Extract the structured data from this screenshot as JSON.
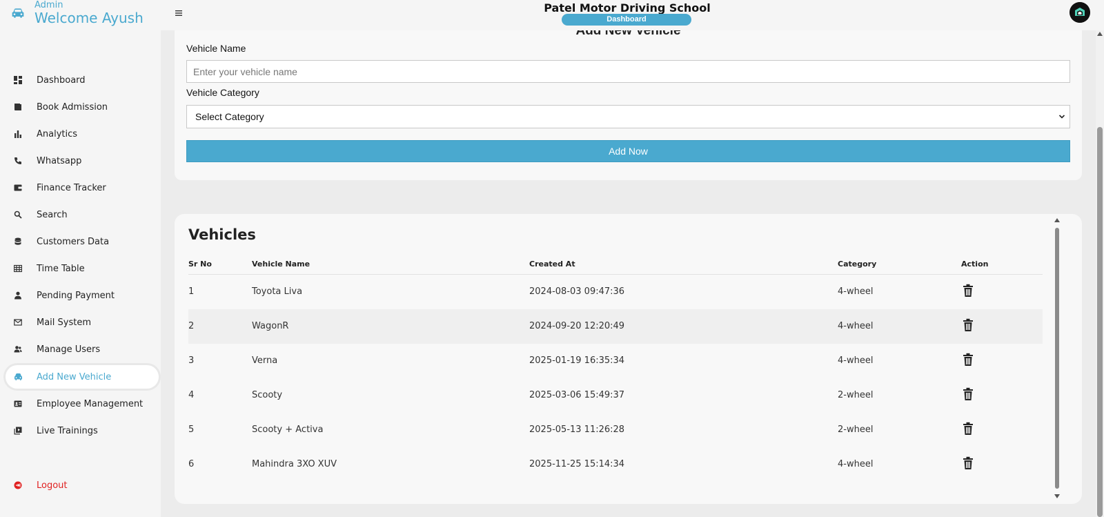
{
  "header": {
    "admin_label": "Admin",
    "welcome": "Welcome Ayush",
    "school_name": "Patel Motor Driving School",
    "badge": "Dashboard"
  },
  "sidebar": {
    "items": [
      {
        "label": "Dashboard",
        "icon": "dashboard-icon"
      },
      {
        "label": "Book Admission",
        "icon": "book-icon"
      },
      {
        "label": "Analytics",
        "icon": "bar-chart-icon"
      },
      {
        "label": "Whatsapp",
        "icon": "phone-icon"
      },
      {
        "label": "Finance Tracker",
        "icon": "wallet-icon"
      },
      {
        "label": "Search",
        "icon": "search-icon"
      },
      {
        "label": "Customers Data",
        "icon": "database-icon"
      },
      {
        "label": "Time Table",
        "icon": "table-icon"
      },
      {
        "label": "Pending Payment",
        "icon": "person-icon"
      },
      {
        "label": "Mail System",
        "icon": "mail-icon"
      },
      {
        "label": "Manage Users",
        "icon": "users-icon"
      },
      {
        "label": "Add New Vehicle",
        "icon": "car-icon"
      },
      {
        "label": "Employee Management",
        "icon": "id-card-icon"
      },
      {
        "label": "Live Trainings",
        "icon": "video-library-icon"
      }
    ],
    "active": "Add New Vehicle",
    "logout": "Logout"
  },
  "form": {
    "heading": "Add New Vehicle",
    "vehicle_name_label": "Vehicle Name",
    "vehicle_name_placeholder": "Enter your vehicle name",
    "vehicle_name_value": "",
    "category_label": "Vehicle Category",
    "category_selected": "Select Category",
    "submit_label": "Add Now"
  },
  "table": {
    "title": "Vehicles",
    "columns": [
      "Sr No",
      "Vehicle Name",
      "Created At",
      "Category",
      "Action"
    ],
    "rows": [
      [
        "1",
        "Toyota Liva",
        "2024-08-03 09:47:36",
        "4-wheel"
      ],
      [
        "2",
        "WagonR",
        "2024-09-20 12:20:49",
        "4-wheel"
      ],
      [
        "3",
        "Verna",
        "2025-01-19 16:35:34",
        "4-wheel"
      ],
      [
        "4",
        "Scooty",
        "2025-03-06 15:49:37",
        "2-wheel"
      ],
      [
        "5",
        "Scooty + Activa",
        "2025-05-13 11:26:28",
        "2-wheel"
      ],
      [
        "6",
        "Mahindra 3XO XUV",
        "2025-11-25 15:14:34",
        "4-wheel"
      ]
    ]
  },
  "colors": {
    "accent": "#4aa9cf",
    "logout": "#e02020",
    "background": "#ececec",
    "card": "#f8f8f8"
  }
}
